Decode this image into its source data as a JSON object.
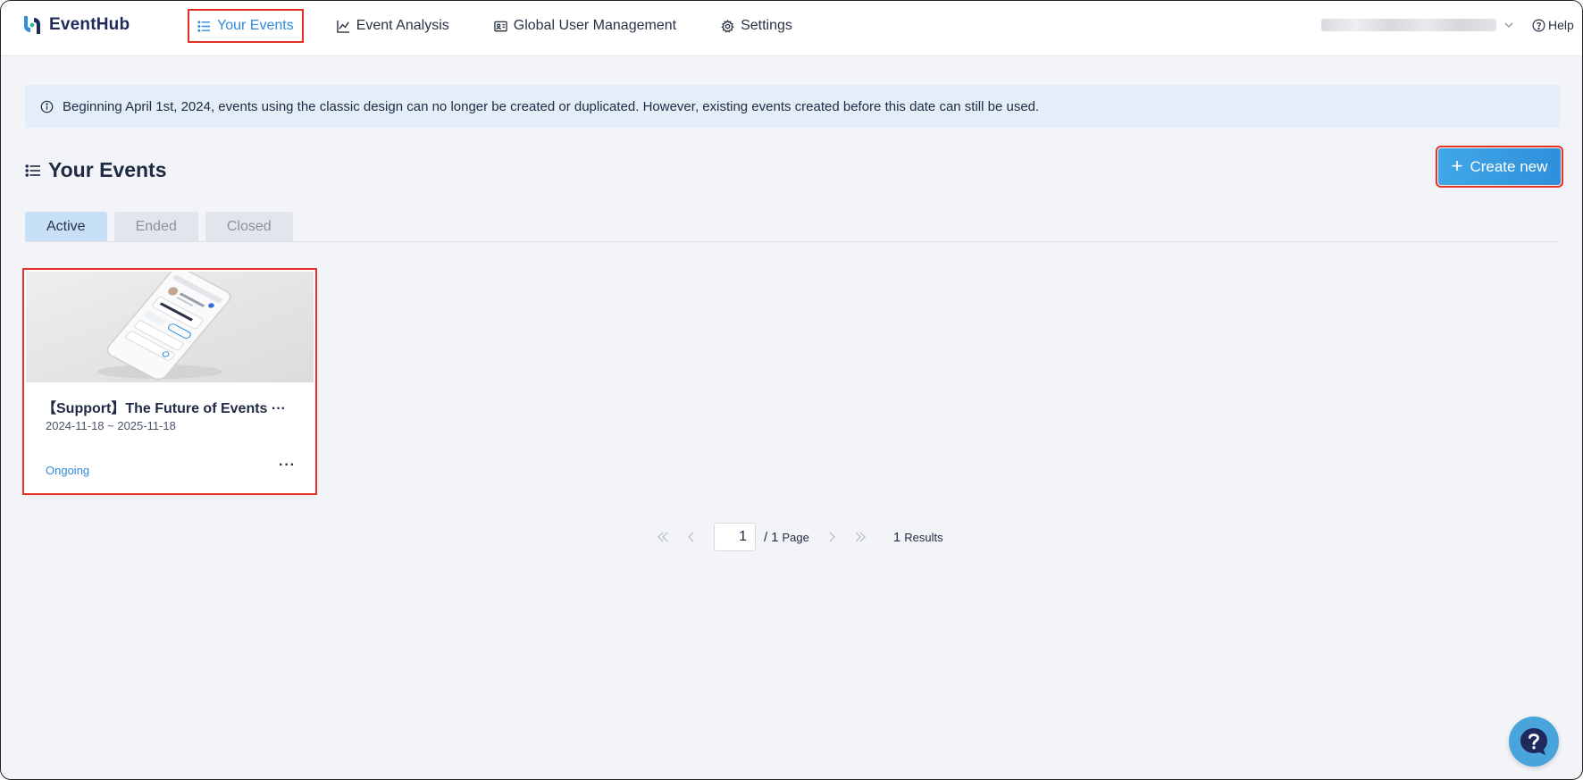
{
  "app": {
    "name": "EventHub"
  },
  "nav": {
    "items": [
      {
        "label": "Your Events",
        "icon": "list-icon",
        "active": true
      },
      {
        "label": "Event Analysis",
        "icon": "chart-line-icon"
      },
      {
        "label": "Global User Management",
        "icon": "id-card-icon"
      },
      {
        "label": "Settings",
        "icon": "gear-icon"
      }
    ],
    "help_label": "Help"
  },
  "notice": {
    "text": "Beginning April 1st, 2024, events using the classic design can no longer be created or duplicated. However, existing events created before this date can still be used."
  },
  "page": {
    "title": "Your Events",
    "create_label": "Create new"
  },
  "tabs": [
    {
      "label": "Active",
      "active": true
    },
    {
      "label": "Ended"
    },
    {
      "label": "Closed"
    }
  ],
  "events": [
    {
      "title": "【Support】The Future of Events ···",
      "dates": "2024-11-18 ~ 2025-11-18",
      "status": "Ongoing",
      "more": "···"
    }
  ],
  "pagination": {
    "current": "1",
    "total": "1",
    "page_label": "Page",
    "results_count": "1",
    "results_label": "Results",
    "separator": "/"
  },
  "colors": {
    "accent": "#2f8bdc",
    "highlight": "#e53226",
    "notice_bg": "#e4eef8"
  }
}
